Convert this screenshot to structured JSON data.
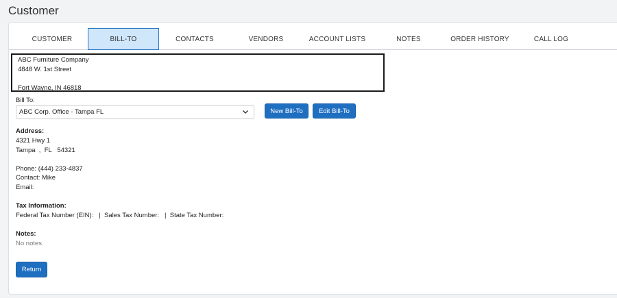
{
  "page": {
    "title": "Customer"
  },
  "tabs": [
    {
      "label": "CUSTOMER"
    },
    {
      "label": "BILL-TO"
    },
    {
      "label": "CONTACTS"
    },
    {
      "label": "VENDORS"
    },
    {
      "label": "ACCOUNT LISTS"
    },
    {
      "label": "NOTES"
    },
    {
      "label": "ORDER HISTORY"
    },
    {
      "label": "CALL LOG"
    }
  ],
  "active_tab": "BILL-TO",
  "customer_address": {
    "line1": "ABC Furniture Company",
    "line2": "4848 W. 1st Street",
    "line3": "",
    "line4": "Fort Wayne, IN 46818"
  },
  "bill_to": {
    "label": "Bill To:",
    "selected": "ABC Corp. Office - Tampa FL",
    "new_button": "New Bill-To",
    "edit_button": "Edit Bill-To"
  },
  "address": {
    "heading": "Address:",
    "line1": "4321 Hwy 1",
    "line2": "Tampa  ,  FL   54321"
  },
  "contact": {
    "phone": "Phone: (444) 233-4837",
    "contact": "Contact: Mike",
    "email": "Email:"
  },
  "tax": {
    "heading": "Tax Information:",
    "line": "Federal Tax Number (EIN):   |  Sales Tax Number:   |  State Tax Number:"
  },
  "notes": {
    "heading": "Notes:",
    "value": "No notes"
  },
  "return_button": "Return",
  "colors": {
    "primary_button": "#1f6fc1",
    "active_tab_bg": "#cfe6fb",
    "active_tab_border": "#2b78c5"
  }
}
